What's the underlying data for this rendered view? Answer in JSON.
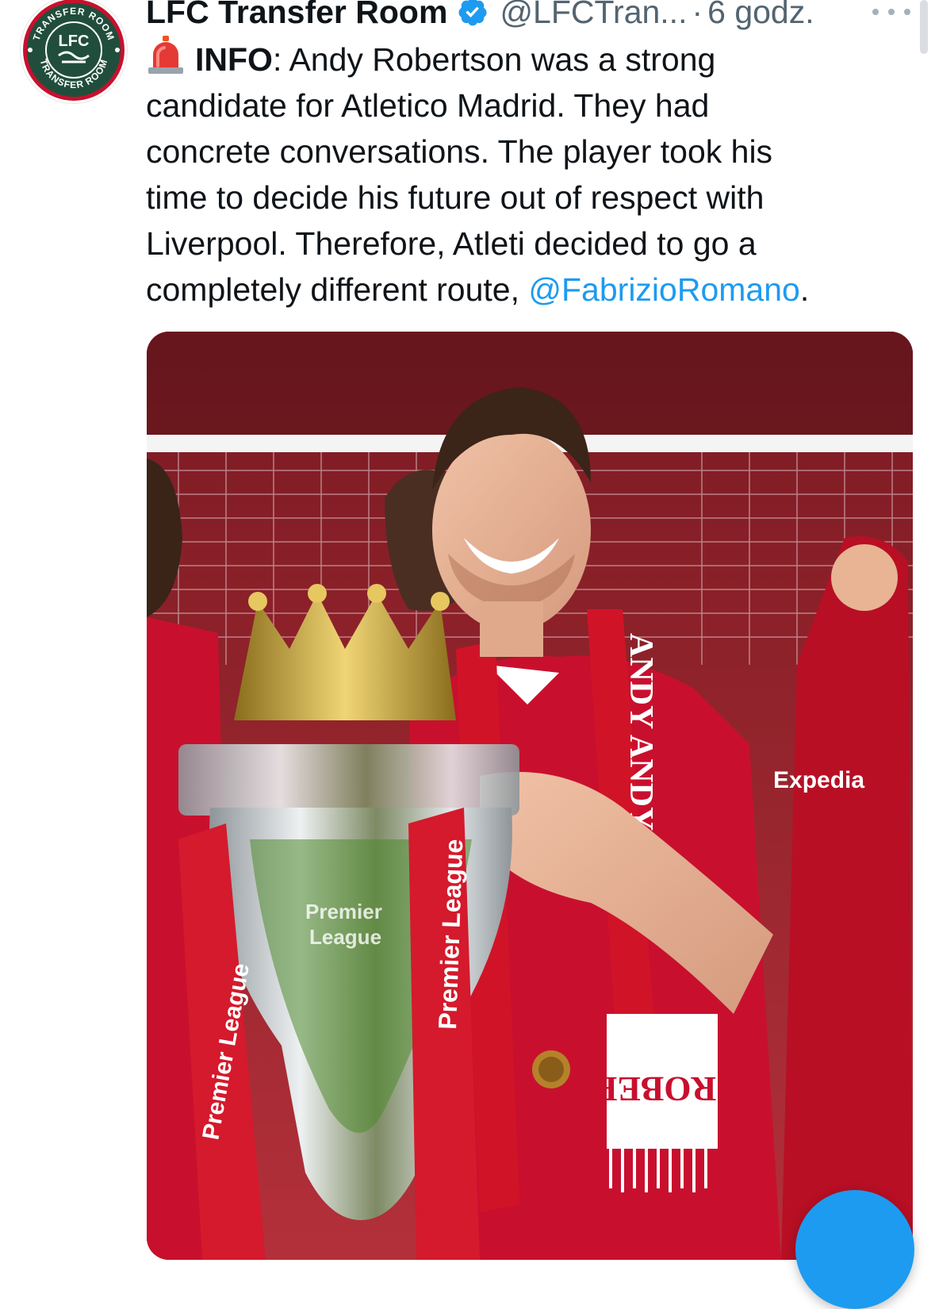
{
  "tweet": {
    "author_name": "LFC Transfer Room",
    "handle": "@LFCTran...",
    "separator": "·",
    "time": "6 godz.",
    "avatar": {
      "ring_top_text": "TRANSFER ROOM",
      "ring_bottom_text": "TRANSFER ROOM",
      "center_text": "LFC"
    },
    "text": {
      "lead_icon": "siren-emoji",
      "lead_label": "INFO",
      "lead_rest": ": Andy Robertson was a strong",
      "line2": "candidate for Atletico Madrid. They had",
      "line3": "concrete conversations. The player took his",
      "line4": "time to decide his future out of respect with",
      "line5": "Liverpool. Therefore, Atleti decided to go a",
      "line6_start": "completely different route, ",
      "mention": "@FabrizioRomano",
      "line6_end": "."
    }
  },
  "media": {
    "scarf_text_1": "ANDY ANDY",
    "scarf_text_2": "ROBER",
    "shirt_sponsor": "Expedia",
    "ribbon_text": "Premier League",
    "trophy_text_1": "Premier",
    "trophy_text_2": "League"
  },
  "colors": {
    "link": "#1d9bf0",
    "muted": "#536471",
    "avatar_dark": "#214e3c",
    "avatar_red": "#c8102e",
    "kit_red": "#c8102e"
  },
  "icons": [
    "verified-badge-icon",
    "more-options-icon",
    "siren-emoji-icon",
    "compose-fab-icon"
  ]
}
